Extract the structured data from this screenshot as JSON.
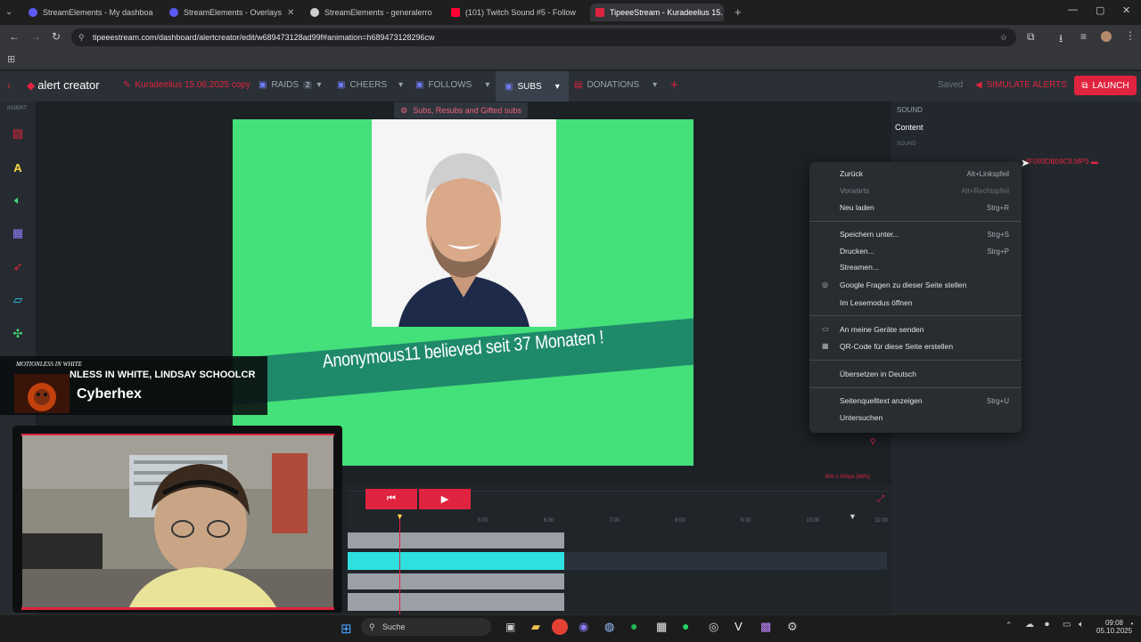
{
  "browser": {
    "tabs": [
      {
        "label": "StreamElements - My dashboa",
        "color": "#5b5cf6"
      },
      {
        "label": "StreamElements - Overlays",
        "color": "#5b5cf6"
      },
      {
        "label": "StreamElements - generalerro",
        "color": "#cfcfcf"
      },
      {
        "label": "(101) Twitch Sound #5 - Follow",
        "color": "#ff0033"
      },
      {
        "label": "TipeeeStream - Kuradeelius 15.",
        "color": "#e0243f"
      }
    ],
    "url": "tipeeestream.com/dashboard/alertcreator/edit/w689473128ad99f#animation=h689473128296cw"
  },
  "app": {
    "logo": "alert creator",
    "alert_name": "Kuradeelius 15.06.2025 copy",
    "nav": {
      "raids": "RAIDS",
      "raids_count": "2",
      "cheers": "CHEERS",
      "follows": "FOLLOWS",
      "subs": "SUBS",
      "donations": "DONATIONS"
    },
    "saved": "Saved",
    "simulate": "SIMULATE ALERTS",
    "launch": "LAUNCH",
    "insert_label": "INSERT",
    "subs_banner": "Subs, Resubs and Gifted subs",
    "alert_text": "Anonymous11 believed seit 37 Monaten !",
    "canvas_size": "800 x 600px (96%)",
    "right_panel": {
      "sound_heading": "SOUND",
      "content": "Content",
      "sound_sub": "SOUND",
      "file": "4F093DB09C9.MP3"
    },
    "timeline_ticks": [
      "5:00",
      "6:00",
      "7:00",
      "8:00",
      "9:00",
      "10:00",
      "11:00"
    ]
  },
  "context_menu": {
    "items": [
      {
        "label": "Zurück",
        "shortcut": "Alt+Linkspfeil",
        "disabled": false
      },
      {
        "label": "Vorwärts",
        "shortcut": "Alt+Rechtspfeil",
        "disabled": true
      },
      {
        "label": "Neu laden",
        "shortcut": "Strg+R",
        "disabled": false
      },
      {
        "label": "Speichern unter...",
        "shortcut": "Strg+S",
        "disabled": false
      },
      {
        "label": "Drucken...",
        "shortcut": "Strg+P",
        "disabled": false
      },
      {
        "label": "Streamen...",
        "shortcut": "",
        "disabled": false
      },
      {
        "label": "Google Fragen zu dieser Seite stellen",
        "shortcut": "",
        "disabled": false
      },
      {
        "label": "Im Lesemodus öffnen",
        "shortcut": "",
        "disabled": false
      },
      {
        "label": "An meine Geräte senden",
        "shortcut": "",
        "disabled": false
      },
      {
        "label": "QR-Code für diese Seite erstellen",
        "shortcut": "",
        "disabled": false
      },
      {
        "label": "Übersetzen in Deutsch",
        "shortcut": "",
        "disabled": false
      },
      {
        "label": "Seitenquelltext anzeigen",
        "shortcut": "Strg+U",
        "disabled": false
      },
      {
        "label": "Untersuchen",
        "shortcut": "",
        "disabled": false
      }
    ]
  },
  "stream_overlay": {
    "song": "NLESS IN WHITE, LINDSAY SCHOOLCR",
    "artist": "Cyberhex",
    "band_logo": "MOTIONLESS IN WHITE"
  },
  "taskbar": {
    "search": "Suche",
    "time": "09:08",
    "date": "05.10.2025"
  },
  "colors": {
    "accent": "#e0243f",
    "green_screen": "#44e07a",
    "ribbon": "#1f8a6a",
    "track": "#2ee0e0"
  }
}
